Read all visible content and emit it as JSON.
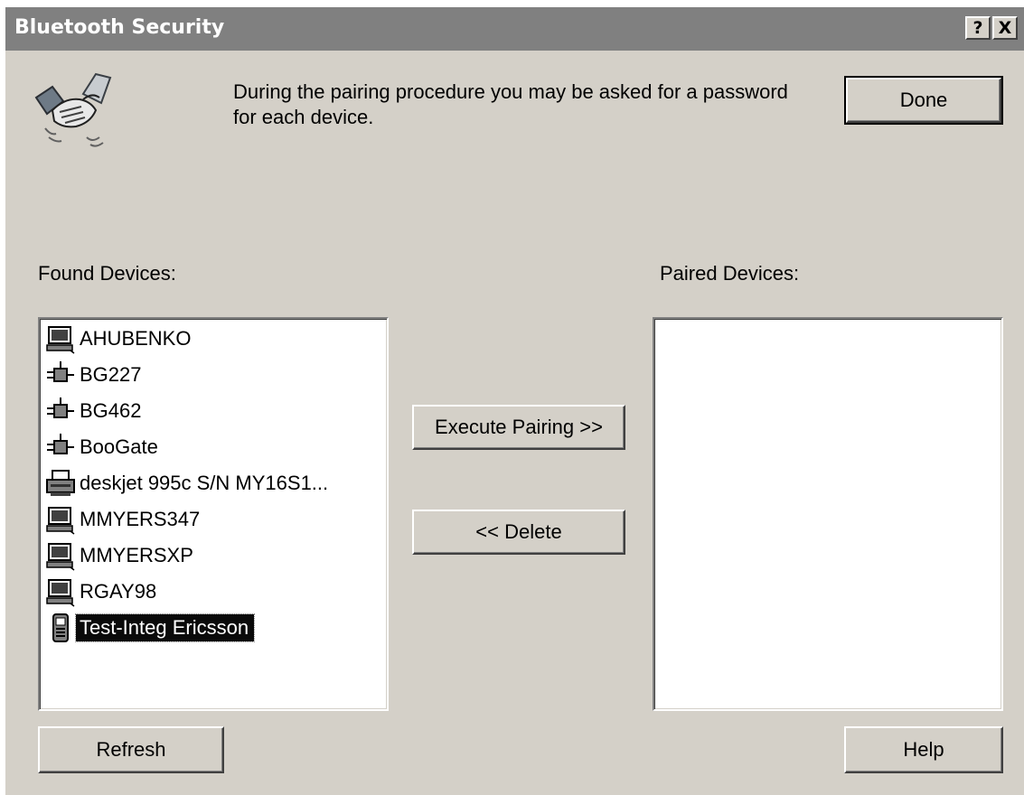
{
  "window": {
    "title": "Bluetooth Security",
    "help_glyph": "?",
    "close_glyph": "X"
  },
  "header": {
    "icon": "handshake-icon",
    "instruction": "During the pairing procedure you may be asked for a password for each device.",
    "done_label": "Done"
  },
  "found_devices": {
    "label": "Found Devices:",
    "items": [
      {
        "icon": "computer-icon",
        "label": "AHUBENKO"
      },
      {
        "icon": "network-access-point-icon",
        "label": "BG227"
      },
      {
        "icon": "network-access-point-icon",
        "label": "BG462"
      },
      {
        "icon": "network-access-point-icon",
        "label": "BooGate"
      },
      {
        "icon": "printer-icon",
        "label": "deskjet 995c S/N MY16S1..."
      },
      {
        "icon": "computer-icon",
        "label": "MMYERS347"
      },
      {
        "icon": "computer-icon",
        "label": "MMYERSXP"
      },
      {
        "icon": "computer-icon",
        "label": "RGAY98"
      },
      {
        "icon": "mobile-phone-icon",
        "label": "Test-Integ Ericsson"
      }
    ],
    "selected_index": 8
  },
  "paired_devices": {
    "label": "Paired Devices:",
    "items": []
  },
  "actions": {
    "execute_pairing_label": "Execute Pairing >>",
    "delete_label": "<< Delete",
    "refresh_label": "Refresh",
    "help_label": "Help"
  },
  "colors": {
    "dialog_face": "#d4d0c8",
    "title_bar": "#808080",
    "selection": "#0a0a0a"
  }
}
